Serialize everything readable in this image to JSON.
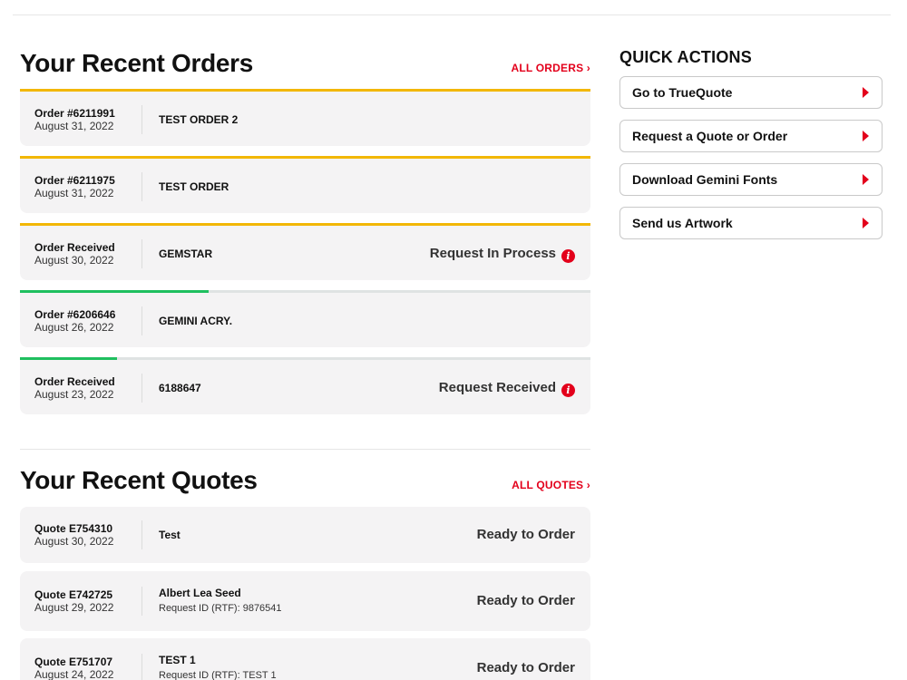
{
  "orders_section": {
    "title": "Your Recent Orders",
    "all_link": "ALL ORDERS ›",
    "items": [
      {
        "id_label": "Order #6211991",
        "date": "August 31, 2022",
        "name": "TEST ORDER 2",
        "status": "",
        "progress": 1.0,
        "progress_color": "#f2b705",
        "has_info": false
      },
      {
        "id_label": "Order #6211975",
        "date": "August 31, 2022",
        "name": "TEST ORDER",
        "status": "",
        "progress": 1.0,
        "progress_color": "#f2b705",
        "has_info": false
      },
      {
        "id_label": "Order Received",
        "date": "August 30, 2022",
        "name": "GEMSTAR",
        "status": "Request In Process",
        "progress": 1.0,
        "progress_color": "#f2b705",
        "has_info": true
      },
      {
        "id_label": "Order #6206646",
        "date": "August 26, 2022",
        "name": "GEMINI ACRY.",
        "status": "",
        "progress": 0.33,
        "progress_color": "#1fbf5f",
        "has_info": false
      },
      {
        "id_label": "Order Received",
        "date": "August 23, 2022",
        "name": "6188647",
        "status": "Request Received",
        "progress": 0.17,
        "progress_color": "#1fbf5f",
        "has_info": true
      }
    ]
  },
  "quotes_section": {
    "title": "Your Recent Quotes",
    "all_link": "ALL QUOTES ›",
    "items": [
      {
        "id_label": "Quote E754310",
        "date": "August 30, 2022",
        "name": "Test",
        "sub": "",
        "status": "Ready to Order"
      },
      {
        "id_label": "Quote E742725",
        "date": "August 29, 2022",
        "name": "Albert Lea Seed",
        "sub": "Request ID (RTF): 9876541",
        "status": "Ready to Order"
      },
      {
        "id_label": "Quote E751707",
        "date": "August 24, 2022",
        "name": "TEST 1",
        "sub": "Request ID (RTF): TEST 1",
        "status": "Ready to Order"
      }
    ]
  },
  "quick_actions": {
    "title": "QUICK ACTIONS",
    "items": [
      {
        "label": "Go to TrueQuote",
        "icon": "arrow-right-icon"
      },
      {
        "label": "Request a Quote or Order",
        "icon": "arrow-right-icon"
      },
      {
        "label": "Download Gemini Fonts",
        "icon": "arrow-right-icon"
      },
      {
        "label": "Send us Artwork",
        "icon": "arrow-right-icon"
      }
    ]
  },
  "colors": {
    "accent": "#e3001b",
    "progress_in_process": "#f2b705",
    "progress_partial": "#1fbf5f",
    "card_bg": "#f4f3f4"
  },
  "icons": {
    "info": "info-icon",
    "action_arrow": "arrow-right-icon"
  },
  "info_glyph": "i"
}
